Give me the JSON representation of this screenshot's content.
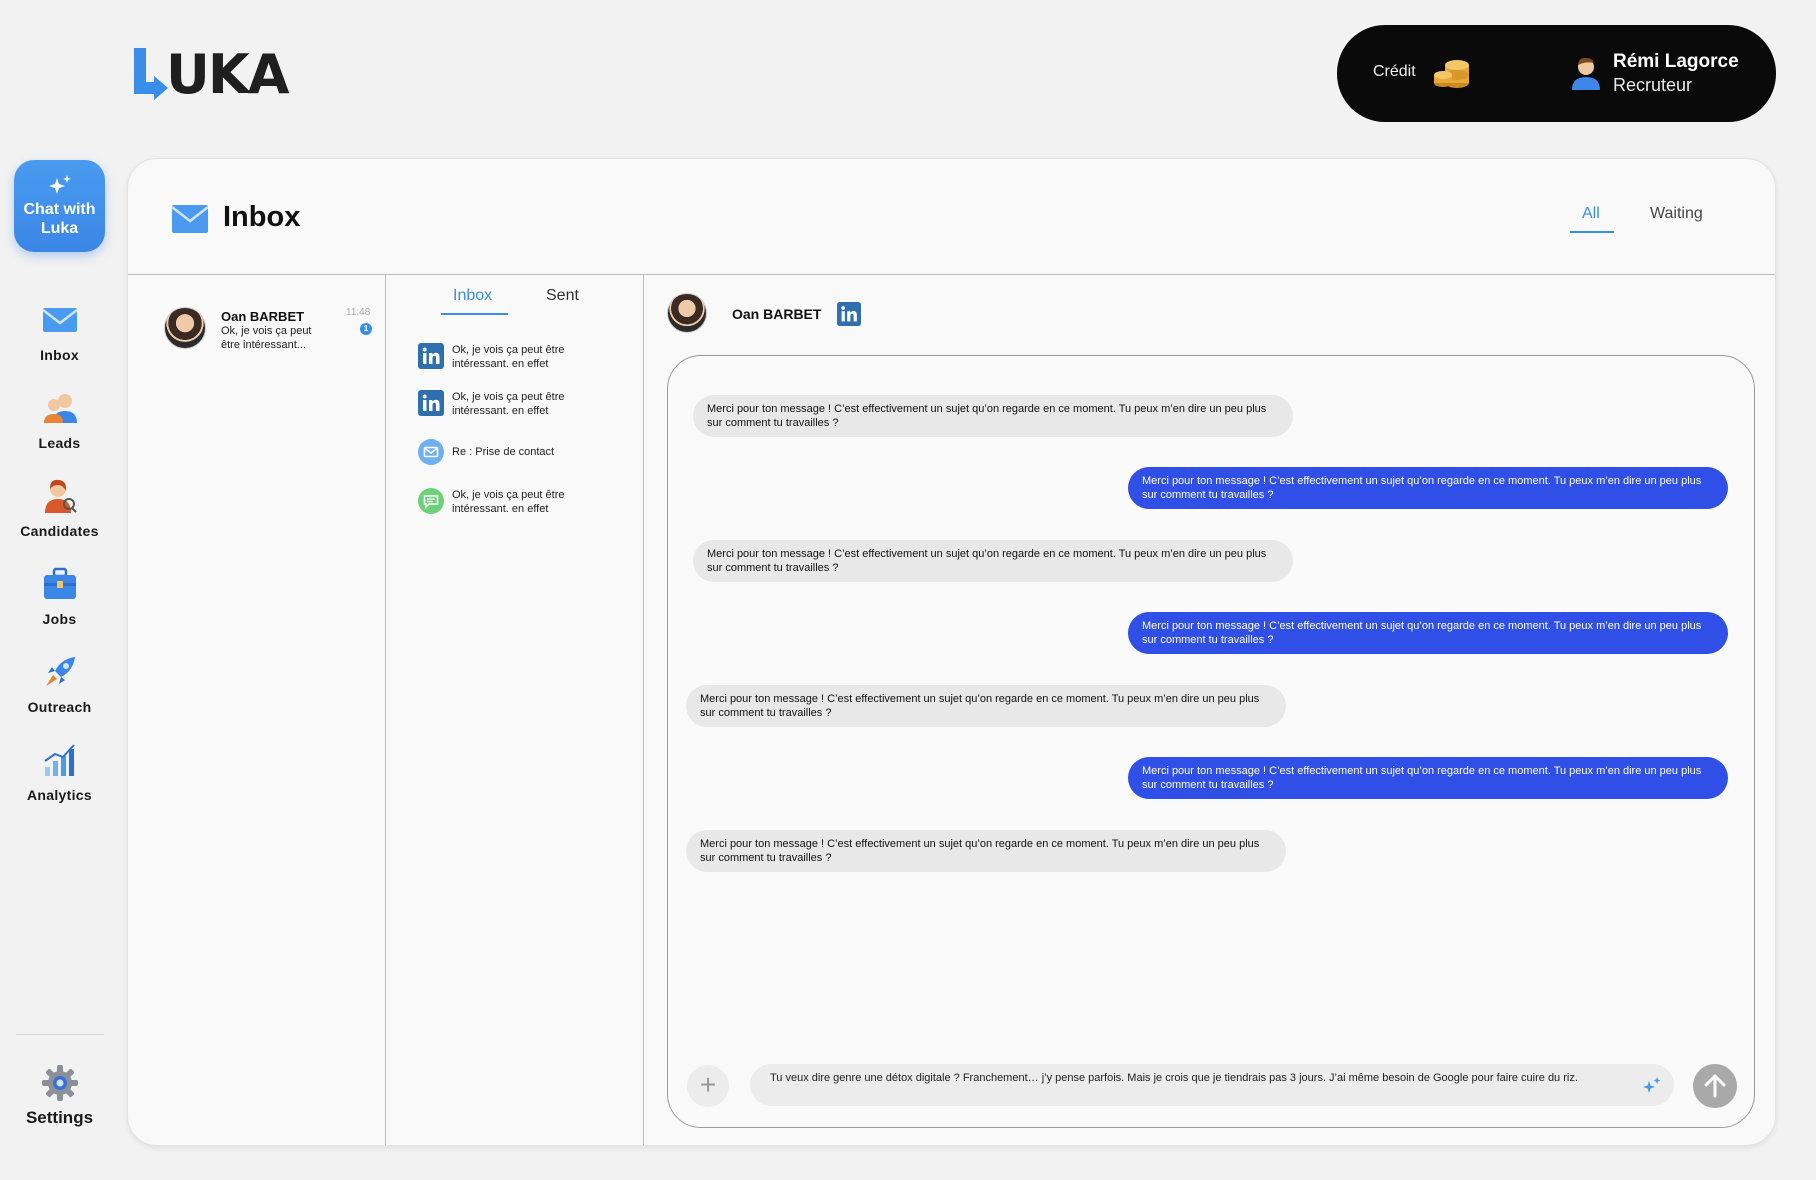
{
  "brand": {
    "logo_text": "UKA",
    "accent": "#3a8de8"
  },
  "account": {
    "credit_label": "Crédit",
    "user_name": "Rémi Lagorce",
    "user_role": "Recruteur"
  },
  "chat_with": "Chat with Luka",
  "nav": {
    "items": [
      {
        "label": "Inbox",
        "icon": "mail-icon"
      },
      {
        "label": "Leads",
        "icon": "leads-icon"
      },
      {
        "label": "Candidates",
        "icon": "candidates-icon"
      },
      {
        "label": "Jobs",
        "icon": "briefcase-icon"
      },
      {
        "label": "Outreach",
        "icon": "rocket-icon"
      },
      {
        "label": "Analytics",
        "icon": "chart-icon"
      }
    ],
    "settings": "Settings"
  },
  "header": {
    "title": "Inbox",
    "filters": [
      "All",
      "Waiting"
    ],
    "active_filter": "All"
  },
  "conversations": [
    {
      "name": "Oan BARBET",
      "preview": "Ok, je vois ça peut être intéressant...",
      "time": "11:48",
      "unread": "1"
    }
  ],
  "subtabs": {
    "inbox": "Inbox",
    "sent": "Sent",
    "active": "Inbox"
  },
  "messages_list": [
    {
      "channel": "linkedin",
      "text": "Ok, je vois ça peut être intéressant. en effet"
    },
    {
      "channel": "linkedin",
      "text": "Ok, je vois ça peut être intéressant. en effet"
    },
    {
      "channel": "email",
      "text": "Re : Prise de contact"
    },
    {
      "channel": "sms",
      "text": "Ok, je vois ça peut être intéressant. en effet"
    }
  ],
  "chat": {
    "contact_name": "Oan BARBET",
    "bubbles": [
      {
        "dir": "in",
        "text": "Merci pour ton message ! C’est effectivement un sujet qu’on regarde en ce moment. Tu peux m’en dire un peu plus sur comment tu travailles ?"
      },
      {
        "dir": "out",
        "text": "Merci pour ton message ! C’est effectivement un sujet qu’on regarde en ce moment. Tu peux m’en dire un peu plus sur comment tu travailles ?"
      },
      {
        "dir": "in",
        "text": "Merci pour ton message ! C’est effectivement un sujet qu’on regarde en ce moment. Tu peux m’en dire un peu plus sur comment tu travailles ?"
      },
      {
        "dir": "out",
        "text": "Merci pour ton message ! C’est effectivement un sujet qu’on regarde en ce moment. Tu peux m’en dire un peu plus sur comment tu travailles ?"
      },
      {
        "dir": "in",
        "text": "Merci pour ton message ! C’est effectivement un sujet qu’on regarde en ce moment. Tu peux m’en dire un peu plus sur comment tu travailles ?"
      },
      {
        "dir": "out",
        "text": "Merci pour ton message ! C’est effectivement un sujet qu’on regarde en ce moment. Tu peux m’en dire un peu plus sur comment tu travailles ?"
      },
      {
        "dir": "in",
        "text": "Merci pour ton message ! C’est effectivement un sujet qu’on regarde en ce moment. Tu peux m’en dire un peu plus sur comment tu travailles ?"
      }
    ],
    "composer_value": "Tu veux dire genre une détox digitale ? Franchement… j’y pense parfois. Mais je crois que je tiendrais pas 3 jours. J’ai même besoin de Google pour faire cuire du riz.",
    "colors": {
      "incoming": "#e8e8e8",
      "outgoing": "#2f4fe6"
    }
  }
}
